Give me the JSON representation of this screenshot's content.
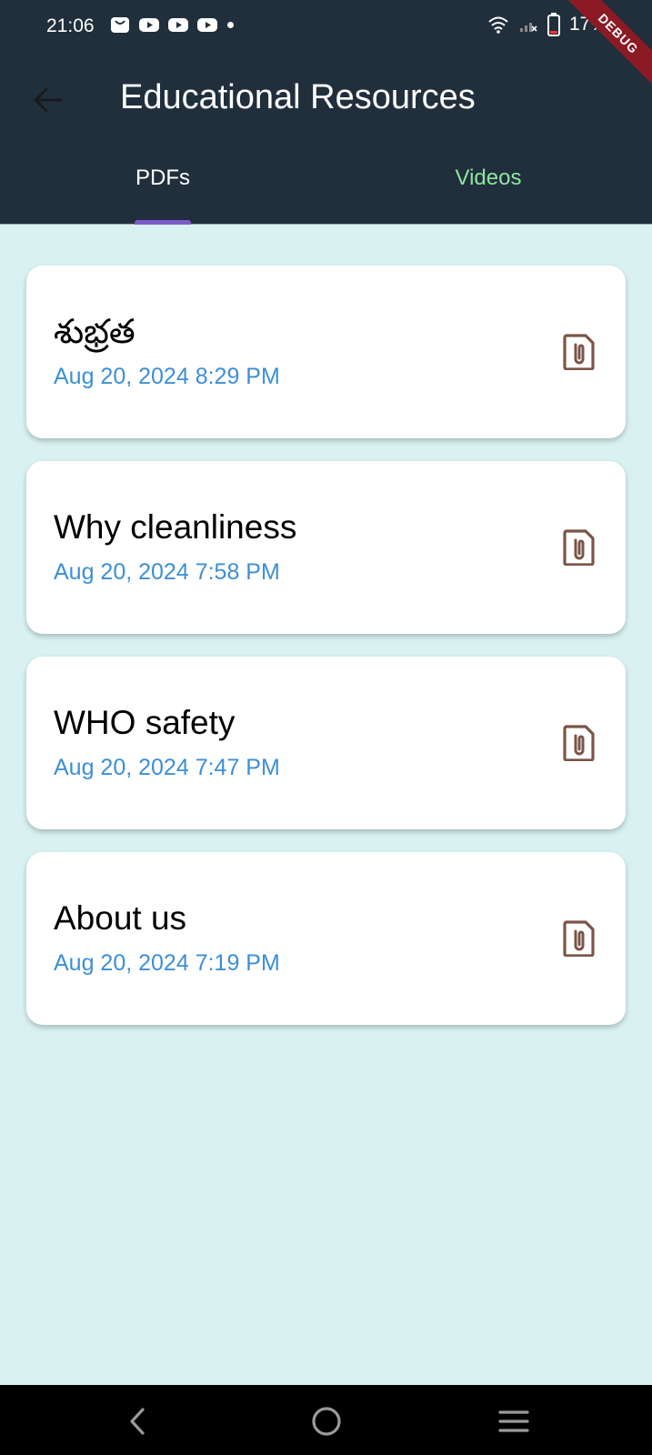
{
  "status_bar": {
    "time": "21:06",
    "battery": "17%",
    "notifications": [
      "shopping-bag-icon",
      "youtube-icon",
      "youtube-icon",
      "youtube-icon"
    ]
  },
  "debug_banner": "DEBUG",
  "header": {
    "title": "Educational Resources",
    "back_icon": "arrow-back-icon"
  },
  "tabs": [
    {
      "label": "PDFs",
      "selected": true
    },
    {
      "label": "Videos",
      "selected": false
    }
  ],
  "documents": [
    {
      "title": "శుభ్రత",
      "date": "Aug 20, 2024 8:29 PM",
      "icon": "pdf-file-icon"
    },
    {
      "title": "Why cleanliness",
      "date": "Aug 20, 2024 7:58 PM",
      "icon": "pdf-file-icon"
    },
    {
      "title": "WHO safety",
      "date": "Aug 20, 2024 7:47 PM",
      "icon": "pdf-file-icon"
    },
    {
      "title": "About us",
      "date": "Aug 20, 2024 7:19 PM",
      "icon": "pdf-file-icon"
    }
  ],
  "colors": {
    "appbar": "#212f3c",
    "background": "#d9f1f1",
    "date_text": "#3d8fd6",
    "videos_tab": "#8ee4a0",
    "tab_indicator": "#7b5cc8",
    "file_icon": "#7a5548"
  }
}
